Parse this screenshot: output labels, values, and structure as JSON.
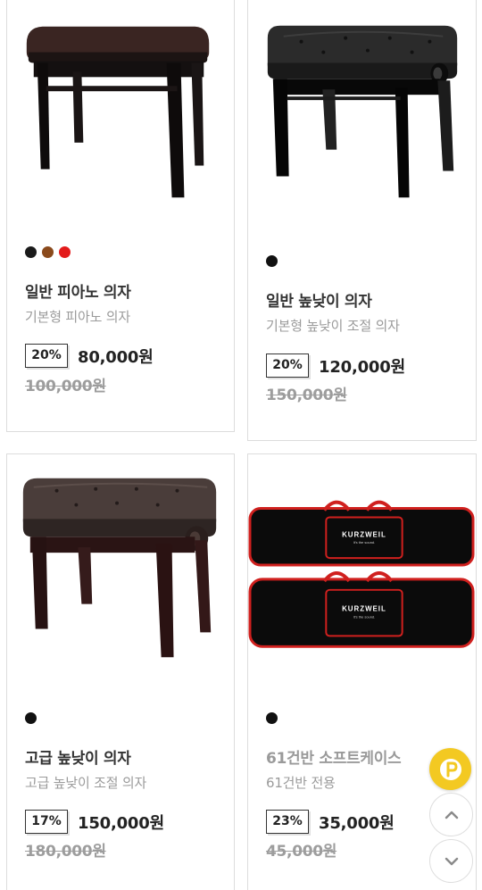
{
  "products": [
    {
      "name": "일반 피아노 의자",
      "description": "기본형 피아노 의자",
      "discount": "20%",
      "price": "80,000원",
      "original_price": "100,000원",
      "colors": [
        "#1a1a1a",
        "#8a4a1c",
        "#e31b1b"
      ],
      "image": "piano-bench-brown-top"
    },
    {
      "name": "일반 높낮이 의자",
      "description": "기본형 높낮이 조절 의자",
      "discount": "20%",
      "price": "120,000원",
      "original_price": "150,000원",
      "colors": [
        "#111111"
      ],
      "image": "adjustable-bench-black"
    },
    {
      "name": "고급 높낮이 의자",
      "description": "고급 높낮이 조절 의자",
      "discount": "17%",
      "price": "150,000원",
      "original_price": "180,000원",
      "colors": [
        "#111111"
      ],
      "image": "adjustable-bench-premium-brown"
    },
    {
      "name": "61건반 소프트케이스",
      "description": "61건반 전용",
      "discount": "23%",
      "price": "35,000원",
      "original_price": "45,000원",
      "colors": [
        "#111111"
      ],
      "image": "keyboard-soft-case",
      "case_brand": "KURZWEIL",
      "case_tagline": "It's the sound."
    }
  ],
  "floating_buttons": {
    "point_icon": "point-coin-icon",
    "up_icon": "chevron-up-icon",
    "down_icon": "chevron-down-icon",
    "point_color": "#f3c922"
  }
}
